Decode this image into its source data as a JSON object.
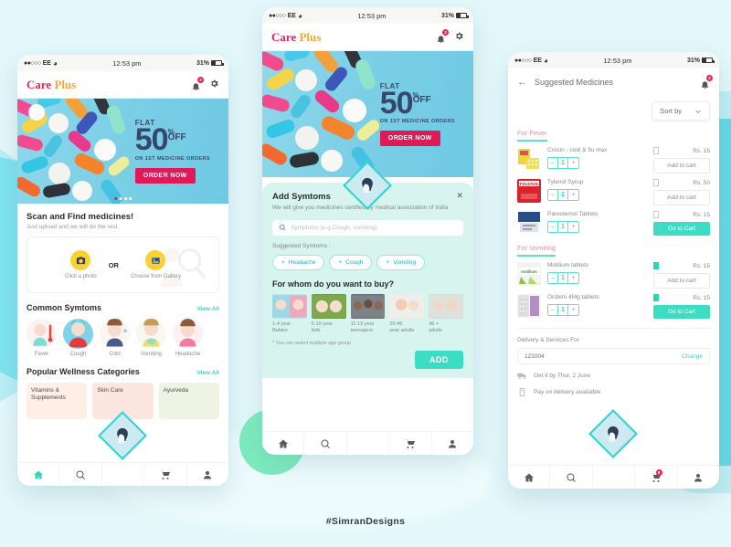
{
  "watermark": "#SimranDesigns",
  "colors": {
    "background": "#e3f8fb",
    "teal": "#2ed6b8",
    "pink": "#e01a59",
    "gold": "#f0a93c",
    "sheet": "#d7f4ee"
  },
  "status_bar": {
    "carrier": "EE",
    "signal_dots": "●●○○○",
    "wifi_icon": "wifi-icon",
    "time": "12:53 pm",
    "battery": "31%"
  },
  "logo": {
    "first": "Care",
    "second": "Plus"
  },
  "notifications": {
    "count": "2",
    "icon": "bell-icon"
  },
  "settings_icon": "gear-icon",
  "banner": {
    "flat": "FLAT",
    "number": "50",
    "percent": "%",
    "off": "OFF",
    "subtitle": "ON 1ST MEDICINE ORDERS",
    "cta": "ORDER NOW",
    "slide_count": 4,
    "active_slide": 1
  },
  "screen1": {
    "scan": {
      "title": "Scan and Find medicines!",
      "subtitle": "Just upload and we will do the rest.",
      "option_camera": "Click a photo",
      "or": "OR",
      "option_gallery": "Choose from Gallery",
      "camera_icon": "camera-icon",
      "gallery_icon": "gallery-icon"
    },
    "symptoms": {
      "title": "Common Symtoms",
      "view_all": "View All",
      "items": [
        {
          "label": "Fever"
        },
        {
          "label": "Cough"
        },
        {
          "label": "Cold"
        },
        {
          "label": "Vomiting"
        },
        {
          "label": "Headache"
        }
      ]
    },
    "categories": {
      "title": "Popular Wellness Categories",
      "view_all": "View All",
      "items": [
        {
          "label": "Vitamins & Supplements"
        },
        {
          "label": "Skin Care"
        },
        {
          "label": "Ayurveda"
        }
      ]
    }
  },
  "screen2": {
    "sheet": {
      "title": "Add Symtoms",
      "close_icon": "close-icon",
      "subtitle": "We will give you medicines certified by medical association of India",
      "search_placeholder": "Symptoms (e.g Cough, vomiting)",
      "search_icon": "search-icon",
      "suggested_label": "Suggested Symtoms :",
      "chips": [
        "Headache",
        "Cough",
        "Vomiting"
      ],
      "question": "For whom do you want to buy?",
      "age_groups": [
        {
          "line1": "1-4 year",
          "line2": "Babies"
        },
        {
          "line1": "5-10 year",
          "line2": "kids"
        },
        {
          "line1": "11-19 year",
          "line2": "teenagers"
        },
        {
          "line1": "20-45",
          "line2": "year adults"
        },
        {
          "line1": "46 +",
          "line2": "adults"
        }
      ],
      "note": "* You can select multiple age group",
      "add_button": "ADD"
    }
  },
  "screen3": {
    "back_icon": "back-arrow-icon",
    "title": "Suggested Medicines",
    "sort_by": "Sort by",
    "chevron_icon": "chevron-down-icon",
    "groups": [
      {
        "title": "For Fever",
        "items": [
          {
            "name": "Crocin - cold & flu max",
            "qty": "1",
            "price": "Rs. 15",
            "action": "Add to cart",
            "action_type": "add",
            "saved": false
          },
          {
            "name": "Tylenol Syrup",
            "qty": "2",
            "price": "Rs. 50",
            "action": "Add to cart",
            "action_type": "add",
            "saved": false
          },
          {
            "name": "Parectemol Tablets",
            "qty": "1",
            "price": "Rs. 15",
            "action": "Go to Cart",
            "action_type": "go",
            "saved": false
          }
        ]
      },
      {
        "title": "For Vomiting",
        "items": [
          {
            "name": "Motilium tablets",
            "qty": "1",
            "price": "Rs. 15",
            "action": "Add to cart",
            "action_type": "add",
            "saved": true
          },
          {
            "name": "Ondem 4Mg tablets",
            "qty": "1",
            "price": "Rs. 15",
            "action": "Go to Cart",
            "action_type": "go",
            "saved": true
          }
        ]
      }
    ],
    "delivery_label": "Delivery & Services For",
    "pincode": "121004",
    "change": "Change",
    "delivery_eta": "Get it by Thur, 2 June",
    "payment_info": "Pay on delivery availaible",
    "truck_icon": "truck-icon",
    "cash_icon": "cash-icon",
    "cart_badge": "0"
  },
  "bottom_nav": {
    "items": [
      {
        "icon": "home-icon",
        "label": "Home"
      },
      {
        "icon": "search-icon",
        "label": "Search"
      },
      {
        "icon": "spacer",
        "label": ""
      },
      {
        "icon": "cart-icon",
        "label": "Cart"
      },
      {
        "icon": "profile-icon",
        "label": "Profile"
      }
    ]
  },
  "stepper": {
    "minus": "–",
    "plus": "+"
  }
}
